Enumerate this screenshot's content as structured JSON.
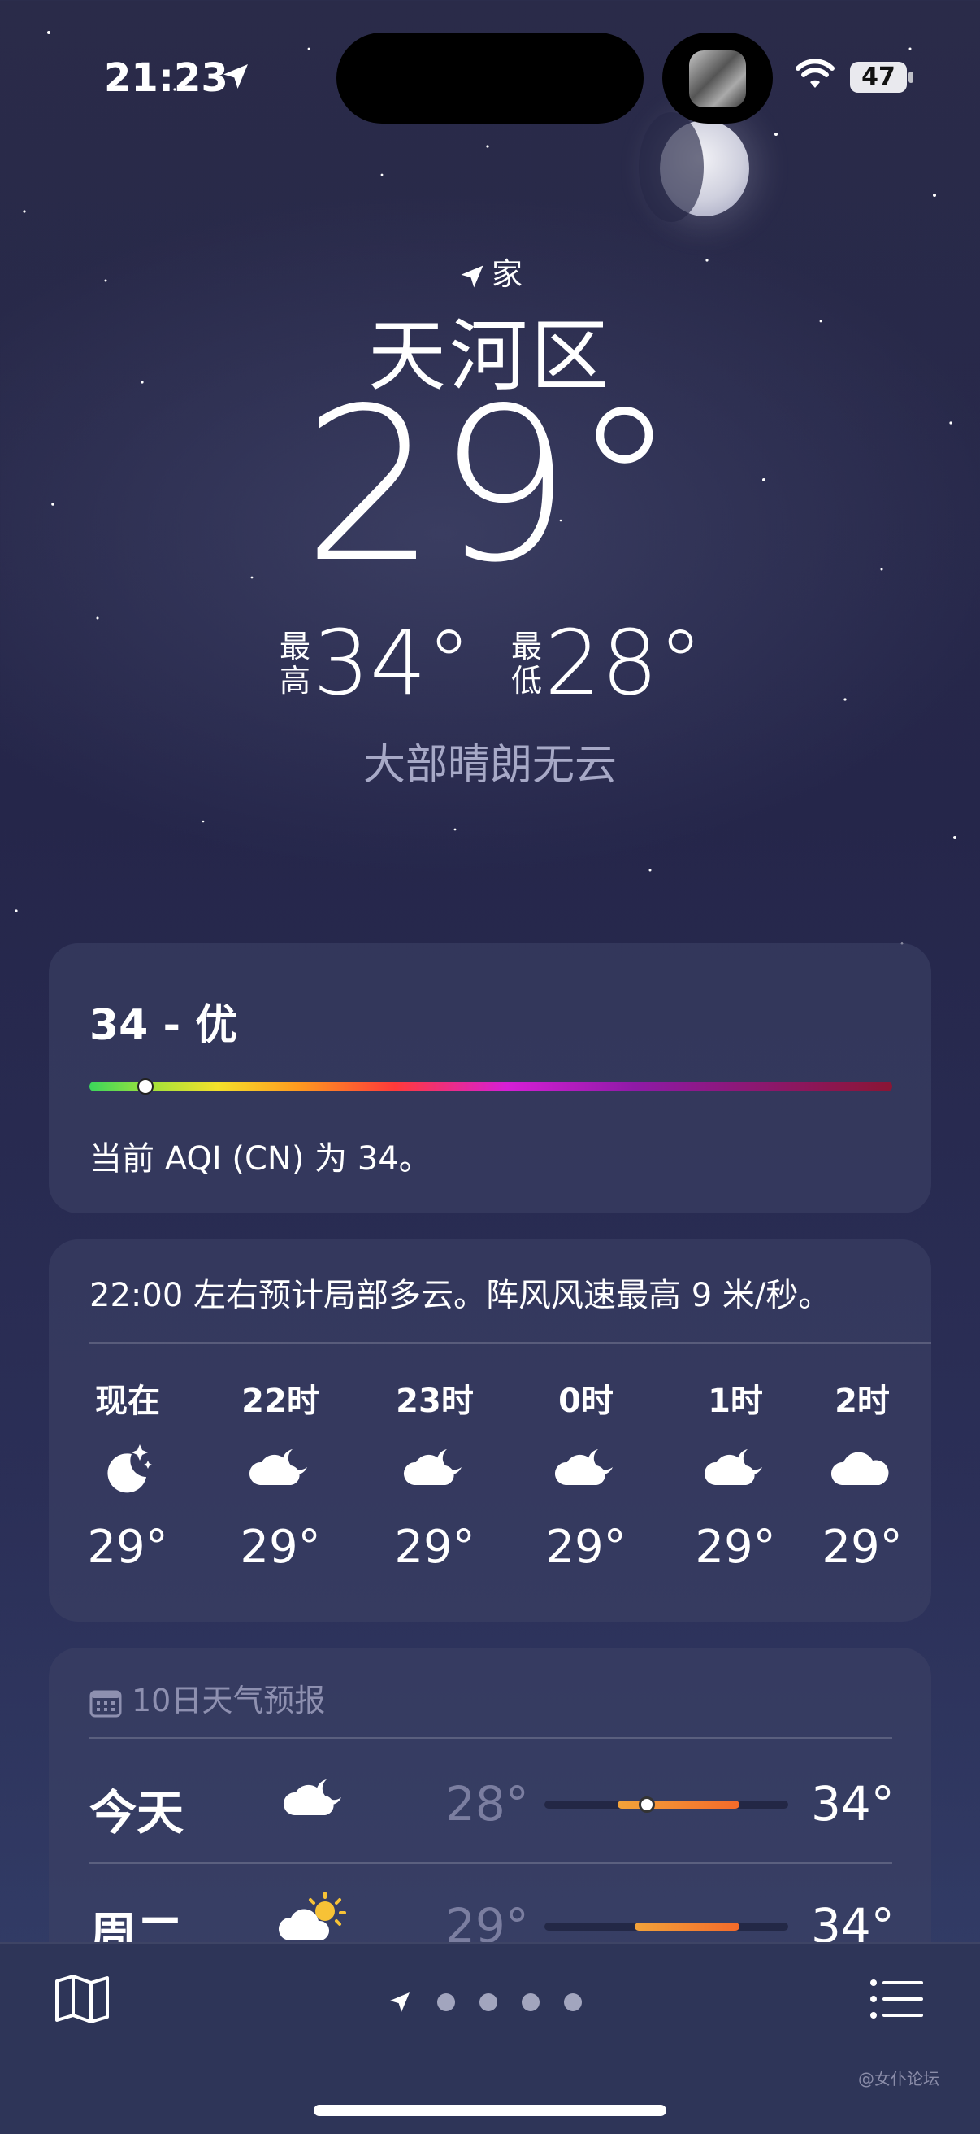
{
  "status_bar": {
    "time": "21:23",
    "battery": "47"
  },
  "location": {
    "home_label": "家",
    "city": "天河区"
  },
  "current": {
    "temperature": "29°",
    "high_label": "最\n高",
    "high_value": "34°",
    "low_label": "最\n低",
    "low_value": "28°",
    "condition": "大部晴朗无云"
  },
  "aqi": {
    "title": "34 - 优",
    "description": "当前 AQI (CN) 为 34。",
    "level": 0.07
  },
  "hourly": {
    "summary": "22:00 左右预计局部多云。阵风风速最高 9 米/秒。",
    "items": [
      {
        "label": "现在",
        "icon": "moon-stars-icon",
        "temp": "29°"
      },
      {
        "label": "22时",
        "icon": "cloud-moon-icon",
        "temp": "29°"
      },
      {
        "label": "23时",
        "icon": "cloud-moon-icon",
        "temp": "29°"
      },
      {
        "label": "0时",
        "icon": "cloud-moon-icon",
        "temp": "29°"
      },
      {
        "label": "1时",
        "icon": "cloud-moon-icon",
        "temp": "29°"
      },
      {
        "label": "2时",
        "icon": "cloud-icon",
        "temp": "29°"
      }
    ]
  },
  "daily": {
    "title": "10日天气预报",
    "days": [
      {
        "name": "今天",
        "icon": "cloud-moon-icon",
        "low": "28°",
        "high": "34°",
        "range_start": 0.3,
        "range_end": 0.8,
        "current": 0.42
      },
      {
        "name": "周二",
        "icon": "cloud-sun-icon",
        "low": "29°",
        "high": "34°",
        "range_start": 0.37,
        "range_end": 0.8
      }
    ]
  },
  "bottom_bar": {
    "page_count": 4,
    "watermark": "@女仆论坛"
  },
  "colors": {
    "background": "#25264a",
    "card": "#3c4064",
    "range_warm": "#f46a2a"
  }
}
